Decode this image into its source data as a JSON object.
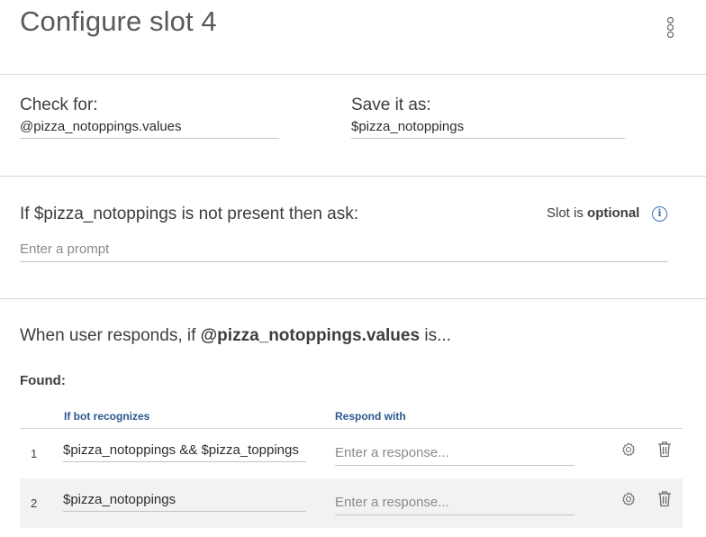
{
  "header": {
    "title": "Configure slot 4",
    "menu_icon": "overflow-menu-vertical-icon"
  },
  "slot": {
    "check_for_label": "Check for:",
    "check_for_value": "@pizza_notoppings.values",
    "save_as_label": "Save it as:",
    "save_as_value": "$pizza_notoppings"
  },
  "prompt": {
    "ask_label": "If $pizza_notoppings is not present then ask:",
    "optional_prefix": "Slot is",
    "optional_value": "optional",
    "info_icon": "info-icon",
    "placeholder": "Enter a prompt"
  },
  "handlers": {
    "responds_prefix": "When user responds, if",
    "responds_entity": "@pizza_notoppings.values",
    "responds_suffix": "is...",
    "found_label": "Found:",
    "columns": [
      "If bot recognizes",
      "Respond with"
    ],
    "rows": [
      {
        "num": "1",
        "condition": "$pizza_notoppings && $pizza_toppings",
        "response_placeholder": "Enter a response..."
      },
      {
        "num": "2",
        "condition": "$pizza_notoppings",
        "response_placeholder": "Enter a response..."
      }
    ],
    "accent_color": "#2a5890",
    "row_alt_color": "#f2f2f2"
  }
}
